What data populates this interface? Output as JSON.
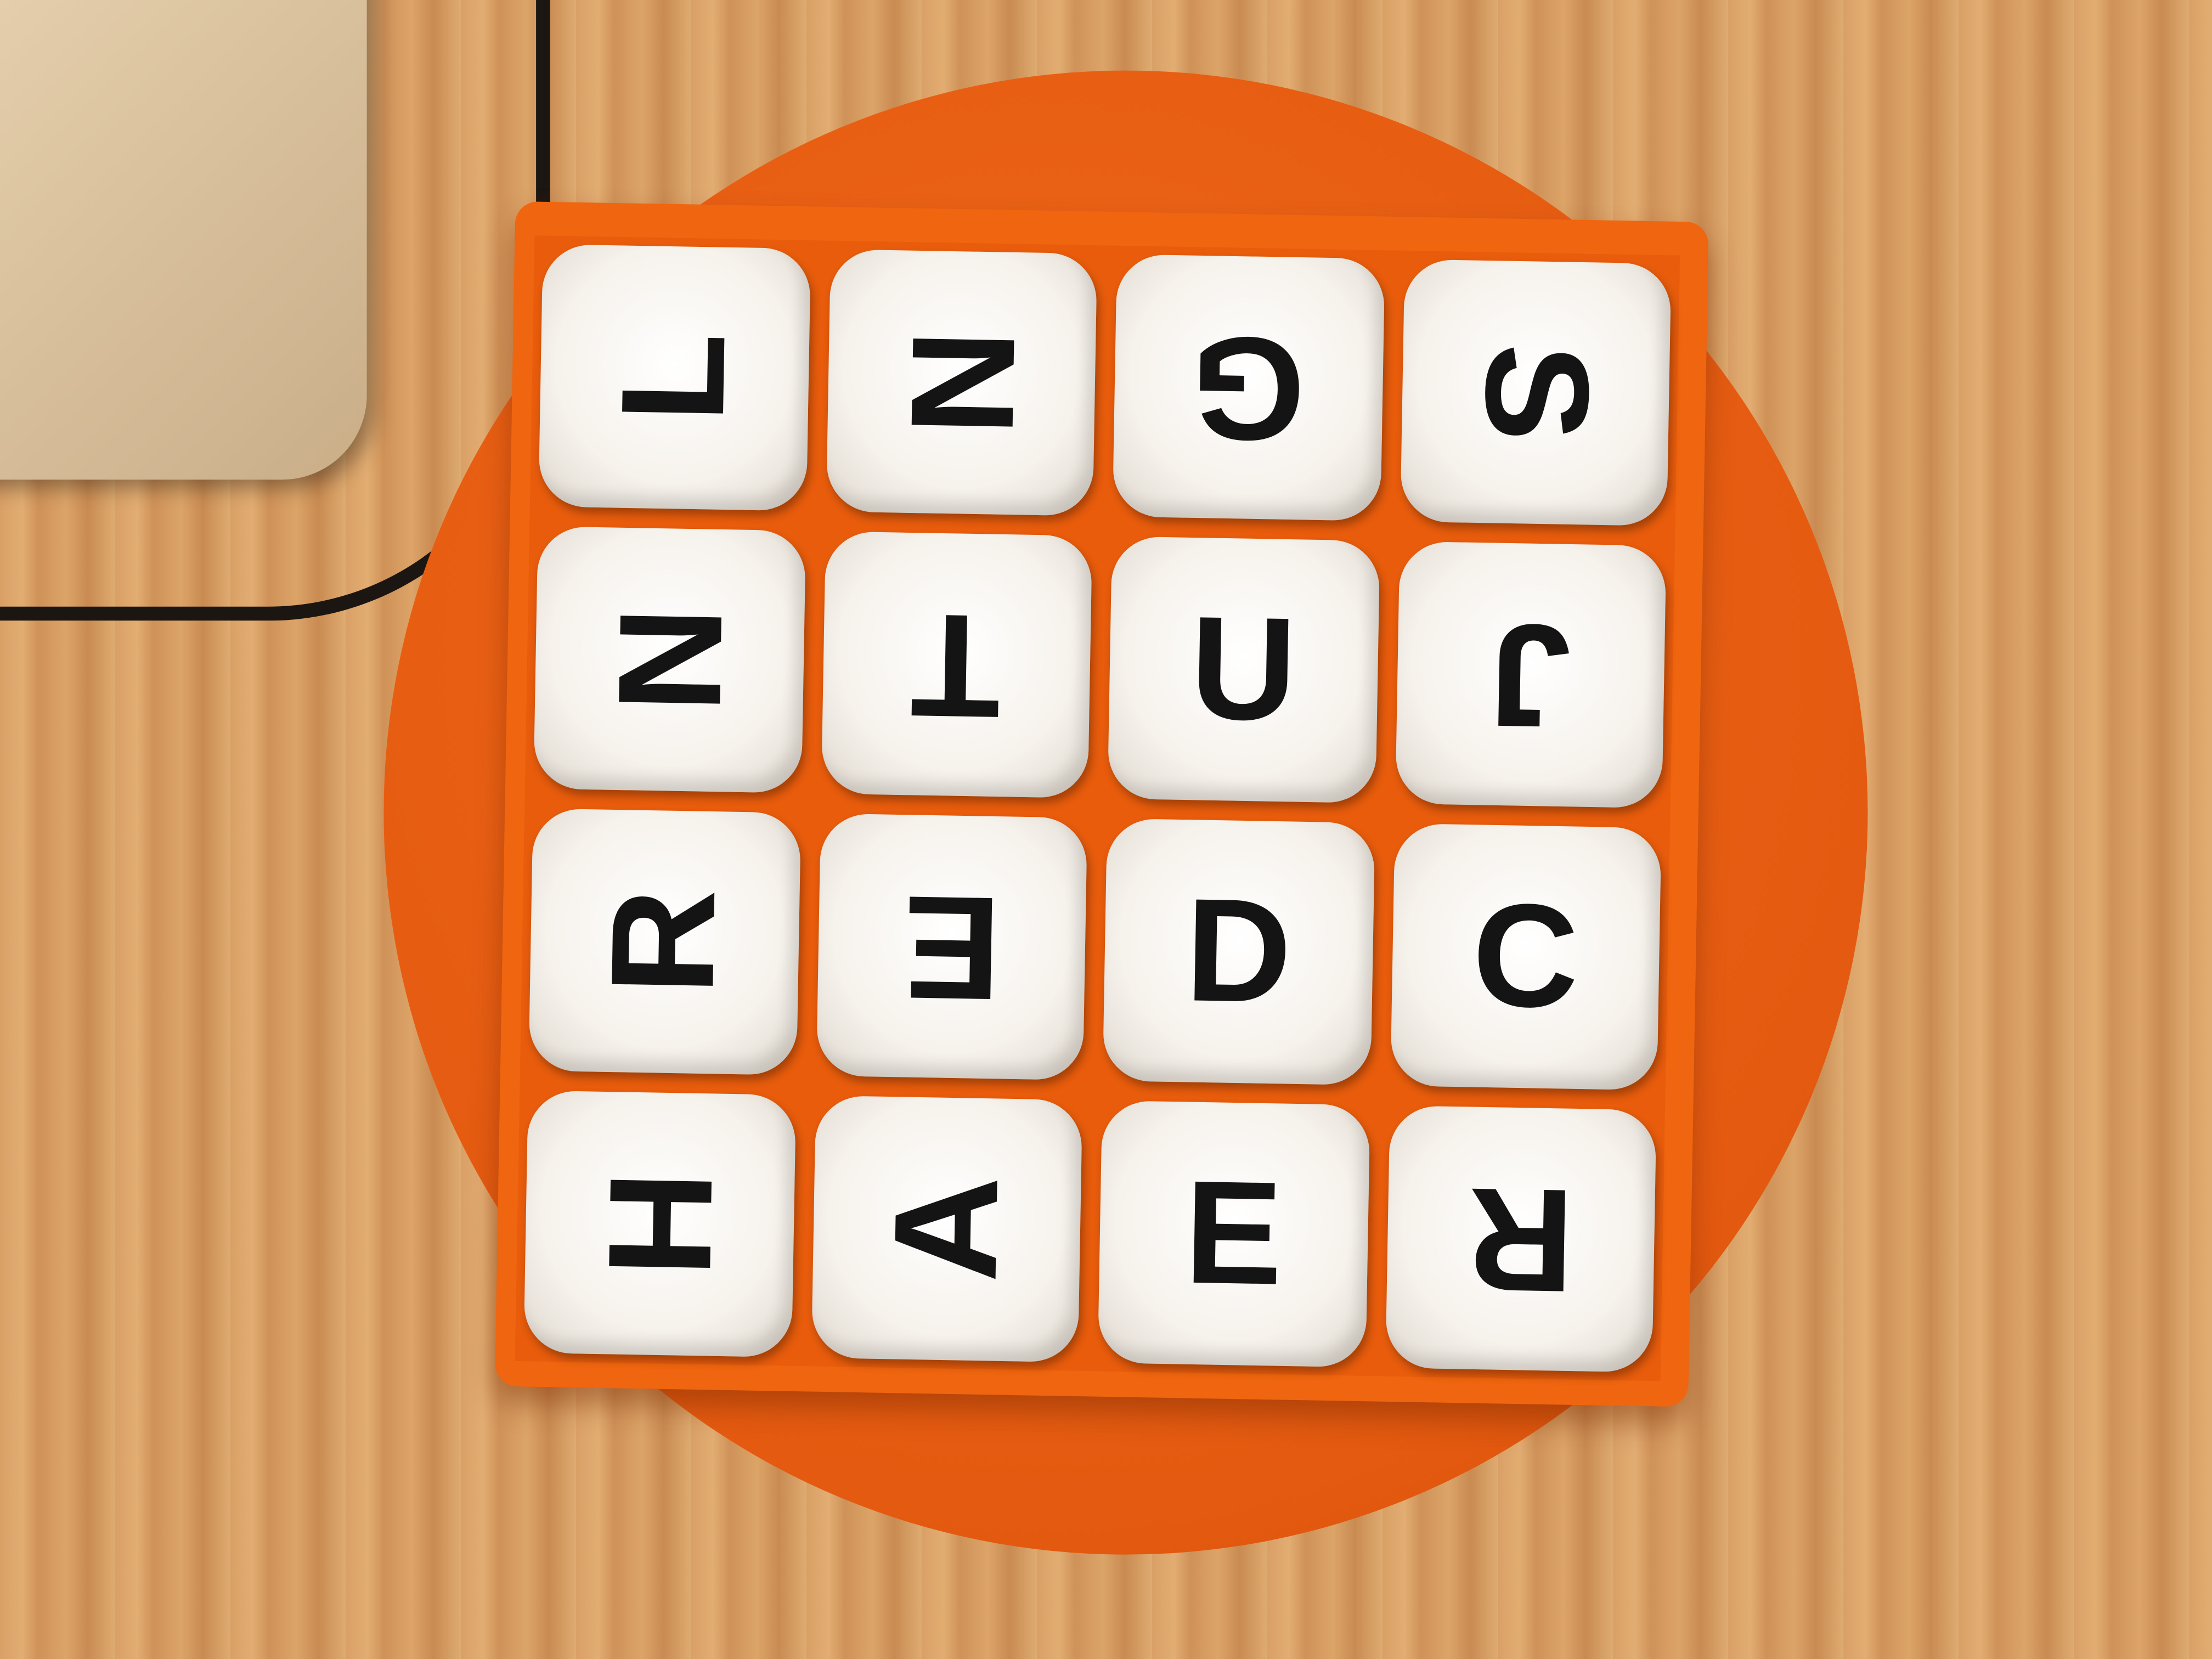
{
  "board": {
    "rows": [
      [
        {
          "letter": "L",
          "rot": -90
        },
        {
          "letter": "N",
          "rot": 90
        },
        {
          "letter": "G",
          "rot": 180
        },
        {
          "letter": "S",
          "rot": 90
        }
      ],
      [
        {
          "letter": "N",
          "rot": 90
        },
        {
          "letter": "T",
          "rot": 180
        },
        {
          "letter": "U",
          "rot": 0
        },
        {
          "letter": "J",
          "rot": 180
        }
      ],
      [
        {
          "letter": "R",
          "rot": -90
        },
        {
          "letter": "E",
          "rot": 180
        },
        {
          "letter": "D",
          "rot": 0
        },
        {
          "letter": "C",
          "rot": 0
        }
      ],
      [
        {
          "letter": "H",
          "rot": 90
        },
        {
          "letter": "A",
          "rot": -90
        },
        {
          "letter": "E",
          "rot": 0
        },
        {
          "letter": "R",
          "rot": 180
        }
      ]
    ]
  },
  "colors": {
    "tray": "#f0650f",
    "disc": "#e45a10",
    "die": "#f6f2ec",
    "letter": "#141414"
  }
}
